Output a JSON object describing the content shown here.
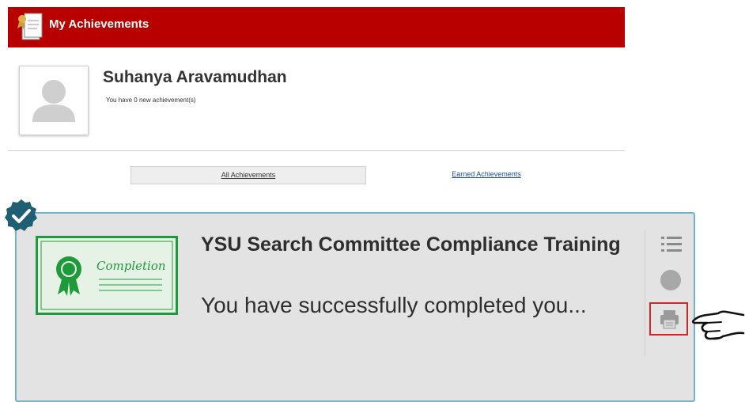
{
  "header": {
    "title": "My Achievements",
    "icon": "certificate-document-icon",
    "color": "#b80000"
  },
  "user": {
    "name": "Suhanya Aravamudhan",
    "subtitle": "You have 0 new achievement(s)",
    "avatar_icon": "user-silhouette-icon"
  },
  "tabs": {
    "all_label": "All Achievements",
    "earned_label": "Earned Achievements",
    "selected": "All Achievements"
  },
  "card": {
    "title": "YSU Search Committee Compliance Training",
    "description": "You have successfully completed you...",
    "certificate_text": "Completion",
    "status_icon": "checkmark-badge-icon",
    "border_color": "#6fb6c9",
    "actions": [
      {
        "icon": "list-icon"
      },
      {
        "icon": "circle-icon"
      },
      {
        "icon": "print-icon"
      }
    ]
  },
  "pointer_icon": "pointing-hand-icon"
}
